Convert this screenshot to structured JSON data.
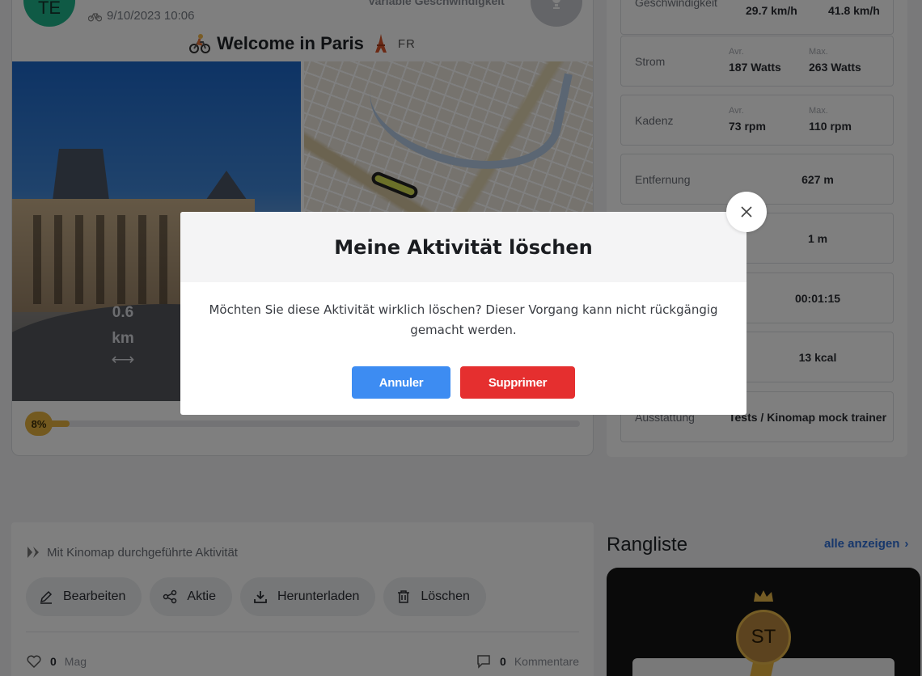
{
  "activity": {
    "avatar_initials": "TE",
    "date": "9/10/2023 10:06",
    "mode_label": "Variable Geschwindigkeit",
    "title": "Welcome in Paris",
    "country": "FR",
    "distance_value": "0.6",
    "distance_unit": "km",
    "progress_label": "8%",
    "progress_fraction": 0.08
  },
  "stats": {
    "speed": {
      "label": "Geschwindigkeit",
      "avg": "29.7 km/h",
      "max": "41.8 km/h"
    },
    "power": {
      "label": "Strom",
      "avg_label": "Avr.",
      "max_label": "Max.",
      "avg": "187 Watts",
      "max": "263 Watts"
    },
    "cadence": {
      "label": "Kadenz",
      "avg_label": "Avr.",
      "max_label": "Max.",
      "avg": "73 rpm",
      "max": "110 rpm"
    },
    "distance": {
      "label": "Entfernung",
      "value": "627 m"
    },
    "elevation": {
      "value": "1 m"
    },
    "duration": {
      "value": "00:01:15"
    },
    "calories": {
      "value": "13 kcal"
    },
    "equipment": {
      "label": "Ausstattung",
      "value": "Tests / Kinomap mock trainer"
    }
  },
  "actions": {
    "kinomap_label": "Mit Kinomap durchgeführte Aktivität",
    "edit": "Bearbeiten",
    "share": "Aktie",
    "download": "Herunterladen",
    "delete": "Löschen",
    "likes_count": "0",
    "likes_label": "Mag",
    "comments_count": "0",
    "comments_label": "Kommentare"
  },
  "leaderboard": {
    "title": "Rangliste",
    "see_all": "alle anzeigen",
    "top_initials": "ST"
  },
  "modal": {
    "title": "Meine Aktivität löschen",
    "message": "Möchten Sie diese Aktivität wirklich löschen? Dieser Vorgang kann nicht rückgängig gemacht werden.",
    "cancel_label": "Annuler",
    "delete_label": "Supprimer"
  },
  "colors": {
    "cancel": "#3d8cf2",
    "delete": "#e52f2f",
    "progress": "#e6b33e",
    "avatar": "#1fb58a",
    "link": "#2f6fd6"
  }
}
